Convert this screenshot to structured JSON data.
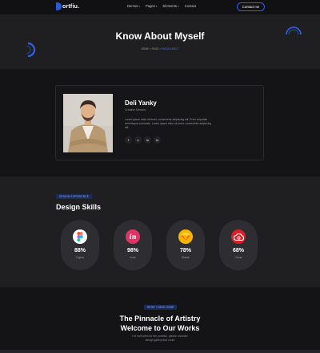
{
  "nav": {
    "logo_text": "ortfiu.",
    "links": [
      "Demos",
      "Pages",
      "Elements",
      "Contact"
    ],
    "contact_label": "Contact me"
  },
  "hero": {
    "title": "Know About Myself",
    "breadcrumb": {
      "home": "HOME",
      "sep1": ">",
      "mid": "PAGE",
      "sep2": ">",
      "current": "KNOW ABOUT"
    }
  },
  "about": {
    "name": "Deli Yanky",
    "role": "Creative Director",
    "bio": "Lorem ipsum dolor sit amet, consectetur adipiscing elit. Proin vulputate scelerisque commodo. Lorem ipsum dolor sit amet, consectetur adipiscing elit.",
    "socials": [
      "f",
      "x",
      "in",
      "in"
    ]
  },
  "skills": {
    "tag": "DESIGN EXPERIENCE",
    "title": "Design Skills",
    "items": [
      {
        "percent": "88%",
        "value": 88,
        "name": "Figma",
        "icon": "figma-icon"
      },
      {
        "percent": "98%",
        "value": 98,
        "name": "Invis",
        "icon": "invision-icon"
      },
      {
        "percent": "78%",
        "value": 78,
        "name": "Sketch",
        "icon": "sketch-icon"
      },
      {
        "percent": "68%",
        "value": 68,
        "name": "Cloud",
        "icon": "creative-cloud-icon"
      }
    ]
  },
  "works": {
    "tag": "WHAT I HAVE DONE",
    "title_line1": "The Pinnacle of Artistry",
    "title_line2": "Welcome to Our Works",
    "sub_line1": "I've built sites for the portfolio, please consider",
    "sub_line2": "design gallery that count"
  },
  "colors": {
    "accent": "#2f62e6",
    "background": "#141416",
    "section": "#1f1f22"
  }
}
